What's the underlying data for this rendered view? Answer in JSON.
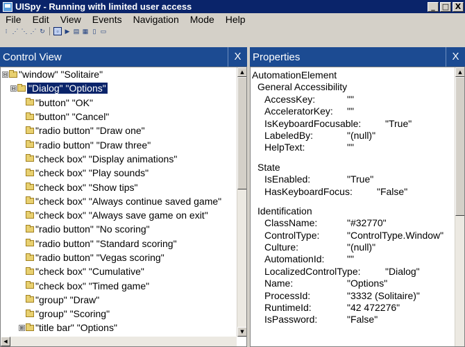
{
  "window": {
    "title": "UISpy - Running with limited user access",
    "min_label": "_",
    "max_label": "□",
    "close_label": "X"
  },
  "menu": {
    "items": [
      "File",
      "Edit",
      "View",
      "Events",
      "Navigation",
      "Mode",
      "Help"
    ]
  },
  "toolbar": {
    "icons": [
      "pointer-icon",
      "tree-icon",
      "tree-walk-icon",
      "focus-icon",
      "refresh-icon",
      "highlight-icon",
      "play-icon",
      "record-icon",
      "screenshot-icon",
      "copy-icon",
      "window-icon"
    ]
  },
  "control_view": {
    "title": "Control View",
    "close_label": "X",
    "items": [
      {
        "expander": "⊟",
        "label": "\"window\" \"Solitaire\""
      },
      {
        "expander": "⊟",
        "label": "\"Dialog\" \"Options\""
      },
      {
        "expander": "",
        "label": "\"button\" \"OK\""
      },
      {
        "expander": "",
        "label": "\"button\" \"Cancel\""
      },
      {
        "expander": "",
        "label": "\"radio button\" \"Draw one\""
      },
      {
        "expander": "",
        "label": "\"radio button\" \"Draw three\""
      },
      {
        "expander": "",
        "label": "\"check box\" \"Display animations\""
      },
      {
        "expander": "",
        "label": "\"check box\" \"Play sounds\""
      },
      {
        "expander": "",
        "label": "\"check box\" \"Show tips\""
      },
      {
        "expander": "",
        "label": "\"check box\" \"Always continue saved game\""
      },
      {
        "expander": "",
        "label": "\"check box\" \"Always save game on exit\""
      },
      {
        "expander": "",
        "label": "\"radio button\" \"No scoring\""
      },
      {
        "expander": "",
        "label": "\"radio button\" \"Standard scoring\""
      },
      {
        "expander": "",
        "label": "\"radio button\" \"Vegas scoring\""
      },
      {
        "expander": "",
        "label": "\"check box\" \"Cumulative\""
      },
      {
        "expander": "",
        "label": "\"check box\" \"Timed game\""
      },
      {
        "expander": "",
        "label": "\"group\" \"Draw\""
      },
      {
        "expander": "",
        "label": "\"group\" \"Scoring\""
      },
      {
        "expander": "⊞",
        "label": "\"title bar\" \"Options\""
      }
    ],
    "selected_index": 1
  },
  "properties": {
    "title": "Properties",
    "close_label": "X",
    "root": "AutomationElement",
    "sections": [
      {
        "name": "General Accessibility",
        "rows": [
          {
            "key": "AccessKey:",
            "value": "\"\""
          },
          {
            "key": "AcceleratorKey:",
            "value": "\"\""
          },
          {
            "key": "IsKeyboardFocusable:",
            "value": "\"True\""
          },
          {
            "key": "LabeledBy:",
            "value": "\"(null)\""
          },
          {
            "key": "HelpText:",
            "value": "\"\""
          }
        ]
      },
      {
        "name": "State",
        "rows": [
          {
            "key": "IsEnabled:",
            "value": "\"True\""
          },
          {
            "key": "HasKeyboardFocus:",
            "value": "\"False\""
          }
        ]
      },
      {
        "name": "Identification",
        "rows": [
          {
            "key": "ClassName:",
            "value": "\"#32770\""
          },
          {
            "key": "ControlType:",
            "value": "\"ControlType.Window\""
          },
          {
            "key": "Culture:",
            "value": "\"(null)\""
          },
          {
            "key": "AutomationId:",
            "value": "\"\""
          },
          {
            "key": "LocalizedControlType:",
            "value": "\"Dialog\""
          },
          {
            "key": "Name:",
            "value": "\"Options\""
          },
          {
            "key": "ProcessId:",
            "value": "\"3332 (Solitaire)\""
          },
          {
            "key": "RuntimeId:",
            "value": "\"42 472276\""
          },
          {
            "key": "IsPassword:",
            "value": "\"False\""
          }
        ]
      }
    ]
  }
}
